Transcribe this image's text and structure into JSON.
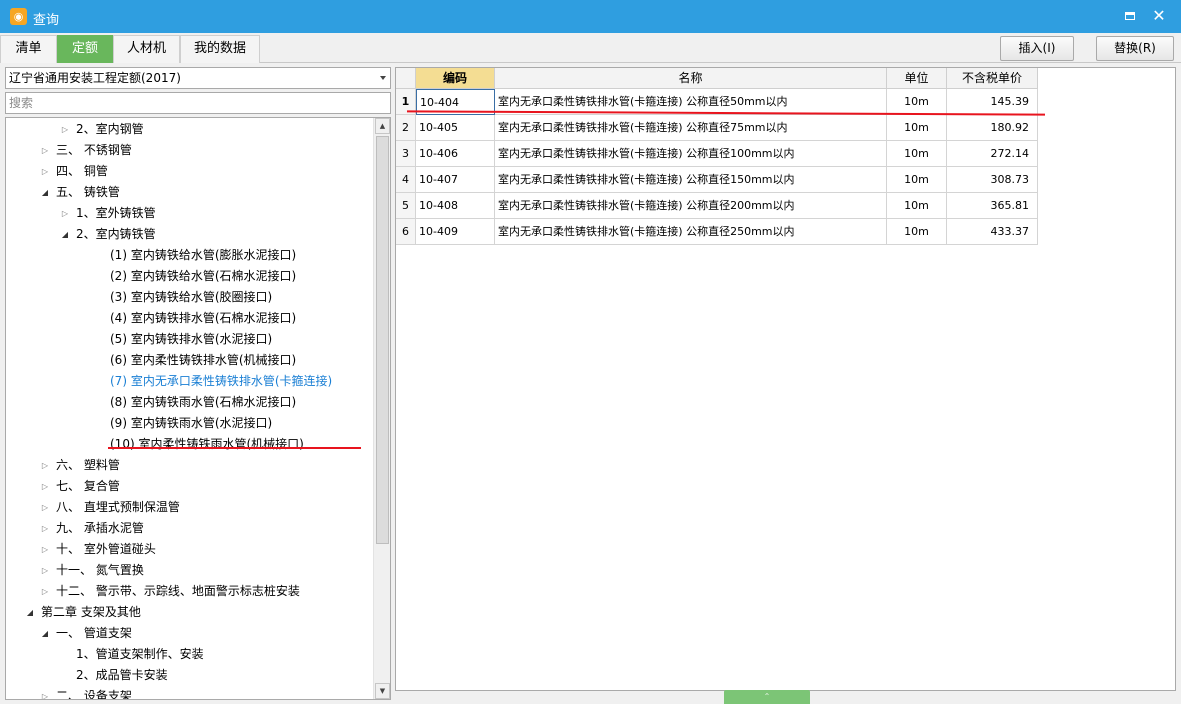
{
  "window": {
    "title": "查询",
    "maximize_icon": "maximize-icon",
    "close_glyph": "✕"
  },
  "tabs": [
    {
      "label": "清单",
      "active": false
    },
    {
      "label": "定额",
      "active": true
    },
    {
      "label": "人材机",
      "active": false
    },
    {
      "label": "我的数据",
      "active": false
    }
  ],
  "toolbar": {
    "insert_label": "插入(I)",
    "replace_label": "替换(R)"
  },
  "left": {
    "library_select": "辽宁省通用安装工程定额(2017)",
    "search_placeholder": "搜索",
    "tree": [
      {
        "label": "2、室内钢管",
        "expander": "closed",
        "level": 2
      },
      {
        "label": "三、 不锈钢管",
        "expander": "closed",
        "level": 1
      },
      {
        "label": "四、 铜管",
        "expander": "closed",
        "level": 1
      },
      {
        "label": "五、 铸铁管",
        "expander": "open",
        "level": 1
      },
      {
        "label": "1、室外铸铁管",
        "expander": "closed",
        "level": 2
      },
      {
        "label": "2、室内铸铁管",
        "expander": "open",
        "level": 2
      },
      {
        "label": "(1) 室内铸铁给水管(膨胀水泥接口)",
        "expander": "none",
        "level": 3
      },
      {
        "label": "(2) 室内铸铁给水管(石棉水泥接口)",
        "expander": "none",
        "level": 3
      },
      {
        "label": "(3) 室内铸铁给水管(胶圈接口)",
        "expander": "none",
        "level": 3
      },
      {
        "label": "(4) 室内铸铁排水管(石棉水泥接口)",
        "expander": "none",
        "level": 3
      },
      {
        "label": "(5) 室内铸铁排水管(水泥接口)",
        "expander": "none",
        "level": 3
      },
      {
        "label": "(6) 室内柔性铸铁排水管(机械接口)",
        "expander": "none",
        "level": 3
      },
      {
        "label": "(7) 室内无承口柔性铸铁排水管(卡箍连接)",
        "expander": "none",
        "level": 3,
        "selected": true
      },
      {
        "label": "(8) 室内铸铁雨水管(石棉水泥接口)",
        "expander": "none",
        "level": 3
      },
      {
        "label": "(9) 室内铸铁雨水管(水泥接口)",
        "expander": "none",
        "level": 3
      },
      {
        "label": "(10) 室内柔性铸铁雨水管(机械接口)",
        "expander": "none",
        "level": 3
      },
      {
        "label": "六、 塑料管",
        "expander": "closed",
        "level": 1
      },
      {
        "label": "七、 复合管",
        "expander": "closed",
        "level": 1
      },
      {
        "label": "八、 直埋式预制保温管",
        "expander": "closed",
        "level": 1
      },
      {
        "label": "九、 承插水泥管",
        "expander": "closed",
        "level": 1
      },
      {
        "label": "十、 室外管道碰头",
        "expander": "closed",
        "level": 1
      },
      {
        "label": "十一、 氮气置换",
        "expander": "closed",
        "level": 1
      },
      {
        "label": "十二、 警示带、示踪线、地面警示标志桩安装",
        "expander": "closed",
        "level": 1
      },
      {
        "label": "第二章 支架及其他",
        "expander": "open",
        "level": 0
      },
      {
        "label": "一、 管道支架",
        "expander": "open",
        "level": 1
      },
      {
        "label": "1、管道支架制作、安装",
        "expander": "none",
        "level": 2
      },
      {
        "label": "2、成品管卡安装",
        "expander": "none",
        "level": 2
      },
      {
        "label": "二、 设备支架",
        "expander": "closed",
        "level": 1
      }
    ]
  },
  "grid": {
    "columns": [
      "编码",
      "名称",
      "单位",
      "不含税单价"
    ],
    "rows": [
      {
        "num": "1",
        "code": "10-404",
        "name": "室内无承口柔性铸铁排水管(卡箍连接) 公称直径50mm以内",
        "unit": "10m",
        "price": "145.39"
      },
      {
        "num": "2",
        "code": "10-405",
        "name": "室内无承口柔性铸铁排水管(卡箍连接) 公称直径75mm以内",
        "unit": "10m",
        "price": "180.92"
      },
      {
        "num": "3",
        "code": "10-406",
        "name": "室内无承口柔性铸铁排水管(卡箍连接) 公称直径100mm以内",
        "unit": "10m",
        "price": "272.14"
      },
      {
        "num": "4",
        "code": "10-407",
        "name": "室内无承口柔性铸铁排水管(卡箍连接) 公称直径150mm以内",
        "unit": "10m",
        "price": "308.73"
      },
      {
        "num": "5",
        "code": "10-408",
        "name": "室内无承口柔性铸铁排水管(卡箍连接) 公称直径200mm以内",
        "unit": "10m",
        "price": "365.81"
      },
      {
        "num": "6",
        "code": "10-409",
        "name": "室内无承口柔性铸铁排水管(卡箍连接) 公称直径250mm以内",
        "unit": "10m",
        "price": "433.37"
      }
    ]
  },
  "colors": {
    "titlebar": "#2f9ee0",
    "active_tab": "#69b75c",
    "code_header": "#f4dd93",
    "annotation": "#e8141e",
    "tree_selected": "#1a7fd4"
  }
}
